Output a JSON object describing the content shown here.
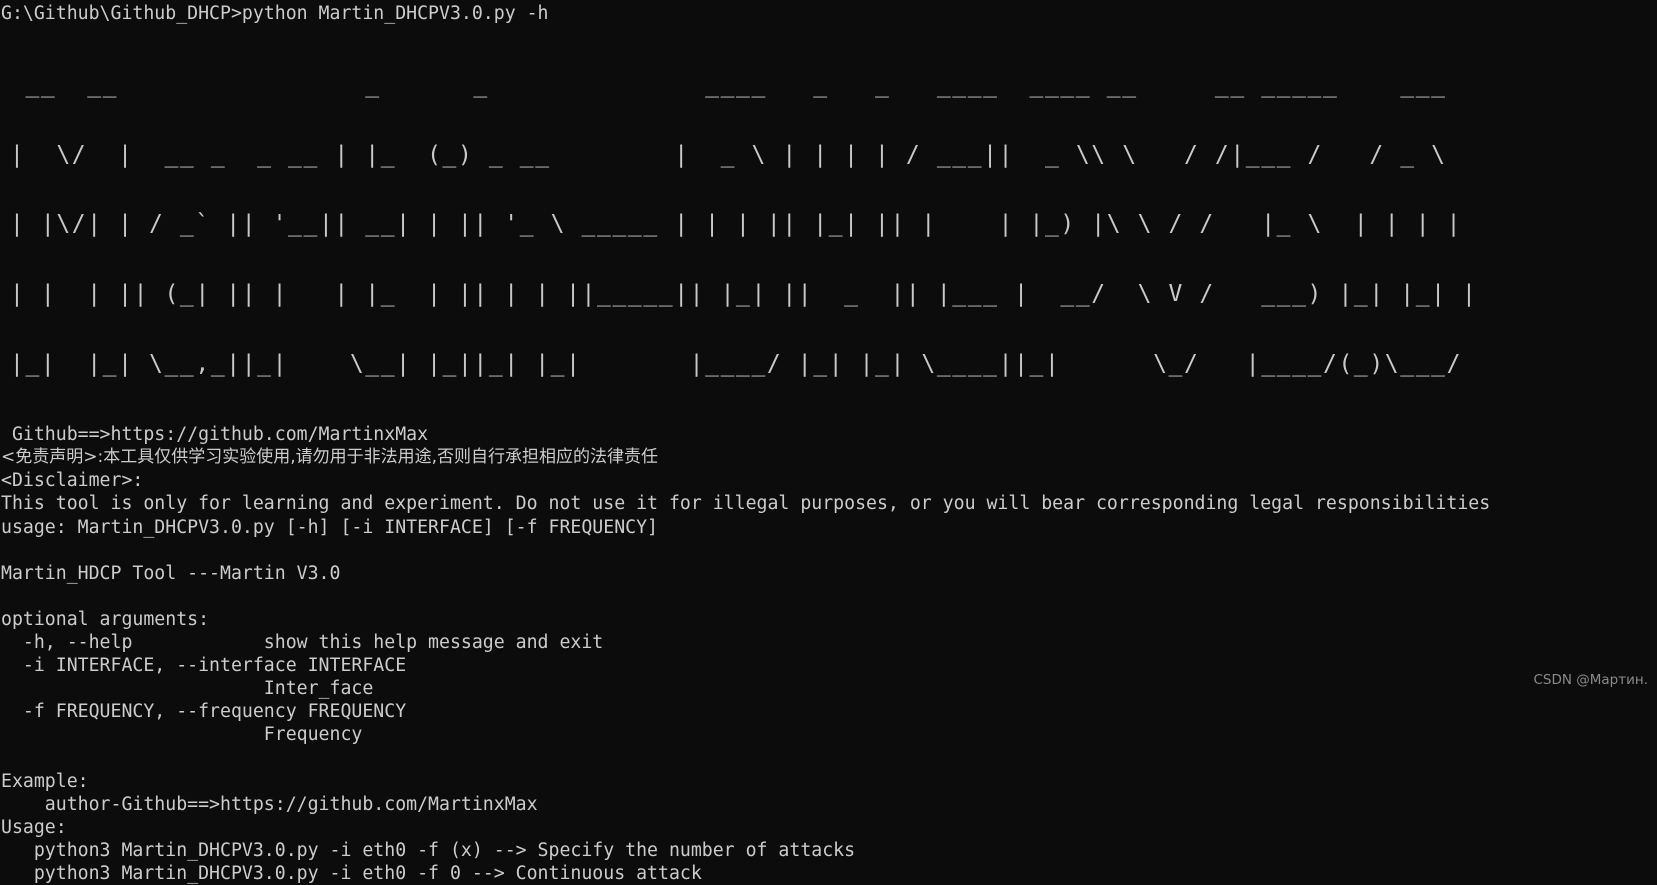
{
  "terminal": {
    "background_color": "#0c0c0c",
    "foreground_color": "#cccccc",
    "prompt_line": "G:\\Github\\Github_DHCP>python Martin_DHCPV3.0.py -h",
    "banner_text": "Martin-DHCPV3.0",
    "banner_rows": [
      " __  __                _      _              ____   _   _   ____  ____ __     __ _____    ___  ",
      "|  \\/  |  __ _  _ __ | |_  (_) _ __        |  _ \\ | | | | / ___||  _ \\\\ \\   / /|___ /   / _ \\ ",
      "| |\\/| | / _` || '__|| __| | || '_ \\ _____ | | | || |_| || |    | |_) |\\ \\ / /   |_ \\  | | | |",
      "| |  | || (_| || |   | |_  | || | | ||_____|| |_| ||  _  || |___ |  __/  \\ V /   ___) |_| |_| |",
      "|_|  |_| \\__,_||_|    \\__| |_||_| |_|       |____/ |_| |_| \\____||_|      \\_/   |____/(_)\\___/ "
    ],
    "github_line": " Github==>https://github.com/MartinxMax",
    "disclaimer_cn_label": "<免责声明>",
    "disclaimer_cn_line": "<免责声明>:本工具仅供学习实验使用,请勿用于非法用途,否则自行承担相应的法律责任",
    "disclaimer_en_label": "<Disclaimer>:",
    "disclaimer_en_line": "This tool is only for learning and experiment. Do not use it for illegal purposes, or you will bear corresponding legal responsibilities",
    "usage_line": "usage: Martin_DHCPV3.0.py [-h] [-i INTERFACE] [-f FREQUENCY]",
    "tool_title_line": "Martin_HDCP Tool ---Martin V3.0",
    "optional_arguments_header": "optional arguments:",
    "option_help": "  -h, --help            show this help message and exit",
    "option_interface": "  -i INTERFACE, --interface INTERFACE",
    "option_interface_desc": "                        Inter_face",
    "option_frequency": "  -f FREQUENCY, --frequency FREQUENCY",
    "option_frequency_desc": "                        Frequency",
    "example_header": "Example:",
    "example_author": "    author-Github==>https://github.com/MartinxMax",
    "usage_header": "Usage:",
    "usage_cmd_1": "   python3 Martin_DHCPV3.0.py -i eth0 -f (x) --> Specify the number of attacks",
    "usage_cmd_2": "   python3 Martin_DHCPV3.0.py -i eth0 -f 0 --> Continuous attack",
    "watermark": "CSDN @Мартин."
  }
}
